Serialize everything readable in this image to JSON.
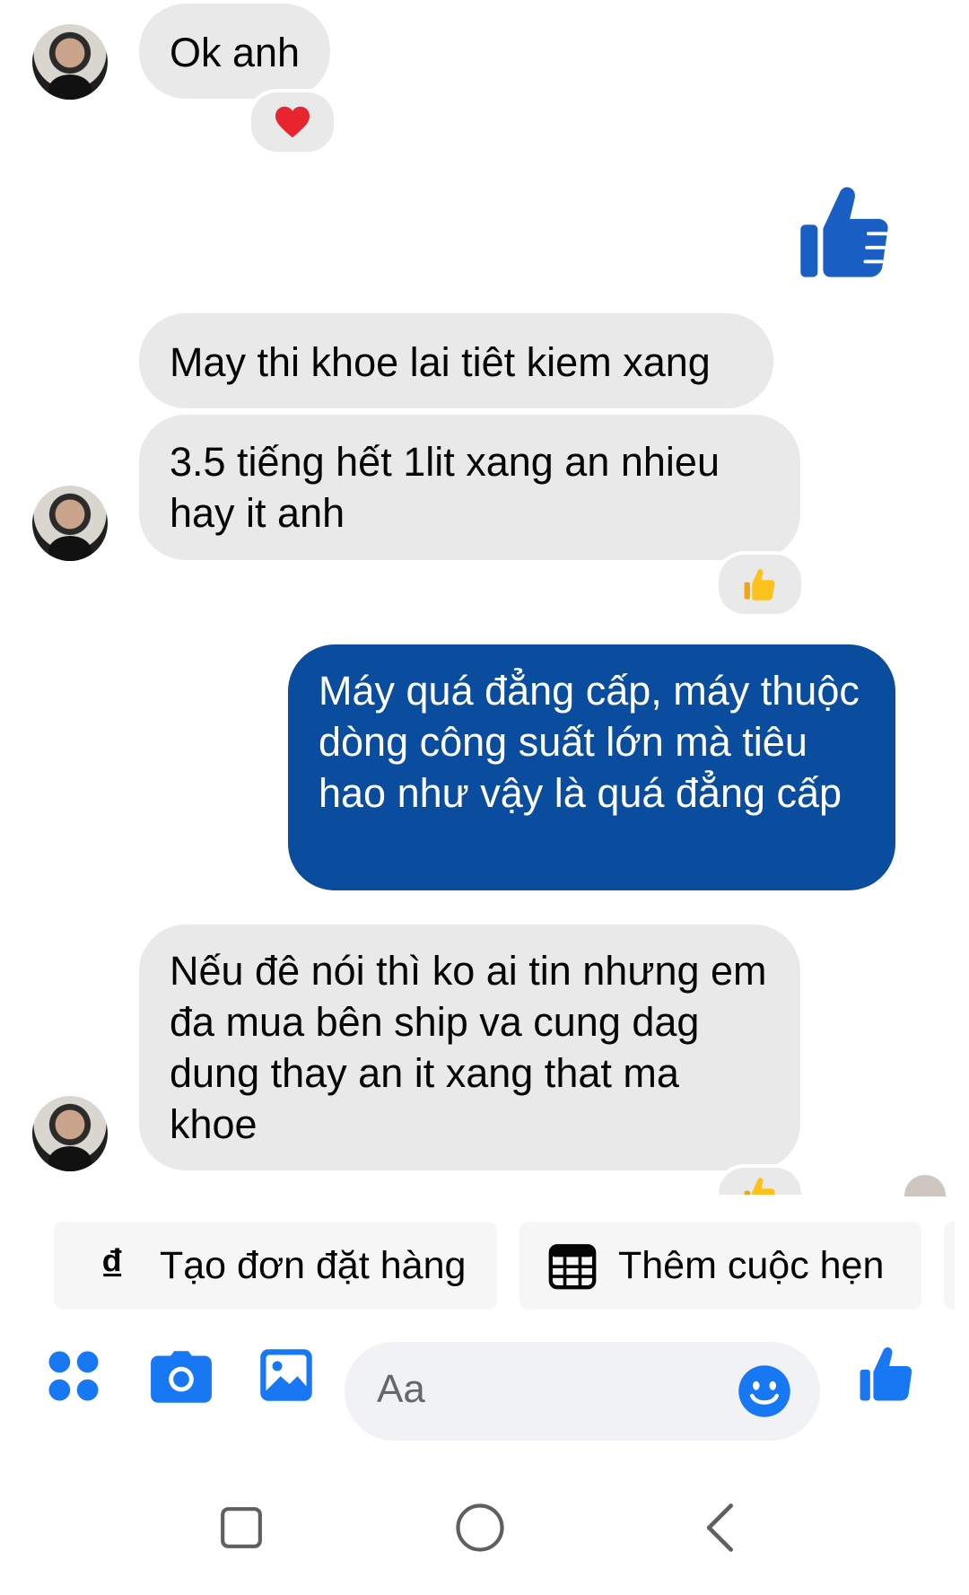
{
  "messages": [
    {
      "id": "m1",
      "sender": "them",
      "text": "Ok anh",
      "reaction": "heart"
    },
    {
      "id": "m2",
      "sender": "me",
      "type": "like-sticker"
    },
    {
      "id": "m3",
      "sender": "them",
      "text": "May thi khoe lai tiêt kiem xang"
    },
    {
      "id": "m4",
      "sender": "them",
      "text": "3.5 tiếng hết 1lit xang an nhieu hay it anh",
      "reaction": "thumbs-up"
    },
    {
      "id": "m5",
      "sender": "me",
      "text": "Máy quá đẳng cấp, máy thuộc dòng công suất lớn mà tiêu hao như vậy là quá đẳng cấp"
    },
    {
      "id": "m6",
      "sender": "them",
      "text": "Nếu đê nói thì ko ai tin nhưng em đa mua bên ship va cung dag dung thay an it xang that ma khoe",
      "reaction": "thumbs-up"
    }
  ],
  "quick_actions": [
    {
      "label": "Tạo đơn đặt hàng",
      "icon": "dong-currency-icon",
      "glyph": "₫"
    },
    {
      "label": "Thêm cuộc hẹn",
      "icon": "calendar-icon"
    }
  ],
  "composer": {
    "placeholder": "Aa",
    "icons": [
      "menu-dots-icon",
      "camera-icon",
      "gallery-icon",
      "emoji-icon",
      "like-icon"
    ]
  },
  "system_nav": [
    "recents-square-icon",
    "home-circle-icon",
    "back-chevron-icon"
  ],
  "colors": {
    "accent": "#1877f2",
    "my_bubble": "#0a4d9e",
    "their_bubble": "#e9e9ea",
    "like_sticker": "#1a5fc4"
  }
}
